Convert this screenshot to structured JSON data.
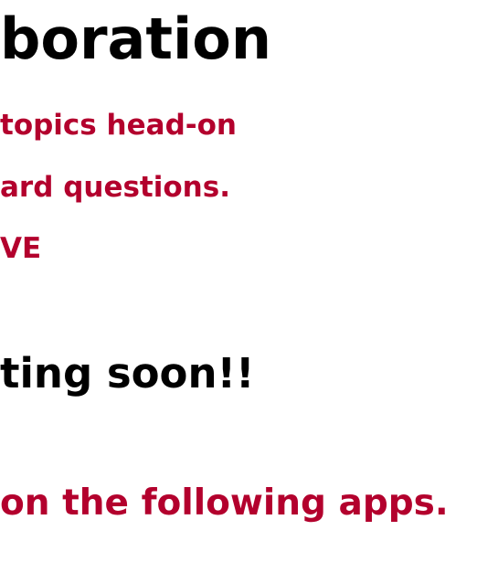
{
  "header": {
    "title": "boration"
  },
  "description": {
    "line1": "topics head-on",
    "line2": "ard questions.",
    "line3": "VE"
  },
  "announcement": {
    "text": "ting soon!!"
  },
  "apps_section": {
    "text": "on the following apps."
  },
  "colors": {
    "accent": "#b3002d",
    "text": "#000000",
    "background": "#ffffff"
  }
}
